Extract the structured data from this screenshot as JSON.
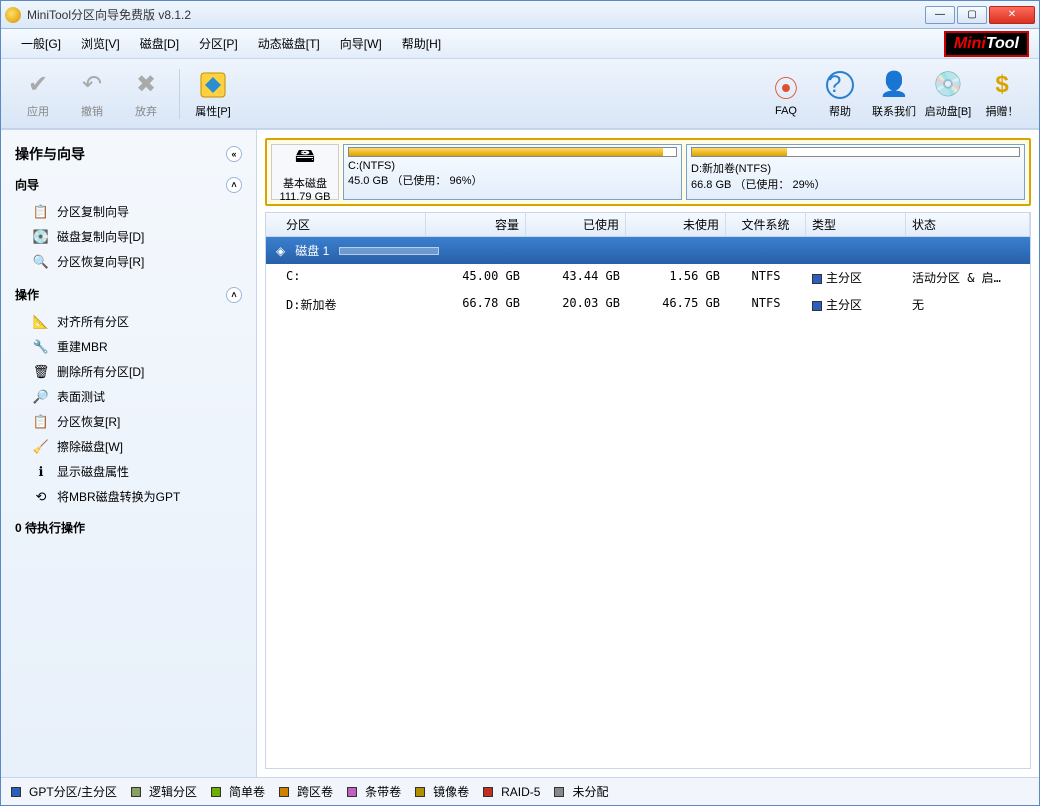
{
  "window": {
    "title": "MiniTool分区向导免费版 v8.1.2"
  },
  "menu": {
    "general": "一般[G]",
    "view": "浏览[V]",
    "disk": "磁盘[D]",
    "partition": "分区[P]",
    "dynamic": "动态磁盘[T]",
    "wizard": "向导[W]",
    "help": "帮助[H]"
  },
  "brand": {
    "mini": "Mini",
    "tool": "Tool"
  },
  "toolbar_left": {
    "apply": "应用",
    "undo": "撤销",
    "discard": "放弃",
    "properties": "属性[P]"
  },
  "toolbar_right": {
    "faq": "FAQ",
    "help": "帮助",
    "contact": "联系我们",
    "bootdisk": "启动盘[B]",
    "donate": "捐赠！"
  },
  "sidebar": {
    "header": "操作与向导",
    "section_wizard": "向导",
    "wizard_items": [
      "分区复制向导",
      "磁盘复制向导[D]",
      "分区恢复向导[R]"
    ],
    "section_ops": "操作",
    "ops_items": [
      "对齐所有分区",
      "重建MBR",
      "删除所有分区[D]",
      "表面测试",
      "分区恢复[R]",
      "擦除磁盘[W]",
      "显示磁盘属性",
      "将MBR磁盘转换为GPT"
    ],
    "pending_count": "0",
    "pending_label": "待执行操作"
  },
  "diskmap": {
    "disk_label": "基本磁盘",
    "disk_size": "111.79 GB",
    "parts": [
      {
        "title": "C:(NTFS)",
        "detail": "45.0 GB （已使用： 96%）",
        "used_pct": 96
      },
      {
        "title": "D:新加卷(NTFS)",
        "detail": "66.8 GB （已使用： 29%）",
        "used_pct": 29
      }
    ]
  },
  "table": {
    "headers": {
      "partition": "分区",
      "capacity": "容量",
      "used": "已使用",
      "unused": "未使用",
      "fs": "文件系统",
      "type": "类型",
      "status": "状态"
    },
    "disk_row": "磁盘 1",
    "rows": [
      {
        "partition": "C:",
        "capacity": "45.00 GB",
        "used": "43.44 GB",
        "unused": "1.56 GB",
        "fs": "NTFS",
        "type": "主分区",
        "status": "活动分区 & 启…",
        "color": "#2a5fc0"
      },
      {
        "partition": "D:新加卷",
        "capacity": "66.78 GB",
        "used": "20.03 GB",
        "unused": "46.75 GB",
        "fs": "NTFS",
        "type": "主分区",
        "status": "无",
        "color": "#2a5fc0"
      }
    ]
  },
  "legend": [
    {
      "color": "#2a5fc0",
      "label": "GPT分区/主分区"
    },
    {
      "color": "#8aa060",
      "label": "逻辑分区"
    },
    {
      "color": "#6ab000",
      "label": "简单卷"
    },
    {
      "color": "#d08000",
      "label": "跨区卷"
    },
    {
      "color": "#c060c0",
      "label": "条带卷"
    },
    {
      "color": "#b09000",
      "label": "镜像卷"
    },
    {
      "color": "#c03020",
      "label": "RAID-5"
    },
    {
      "color": "#888888",
      "label": "未分配"
    }
  ]
}
